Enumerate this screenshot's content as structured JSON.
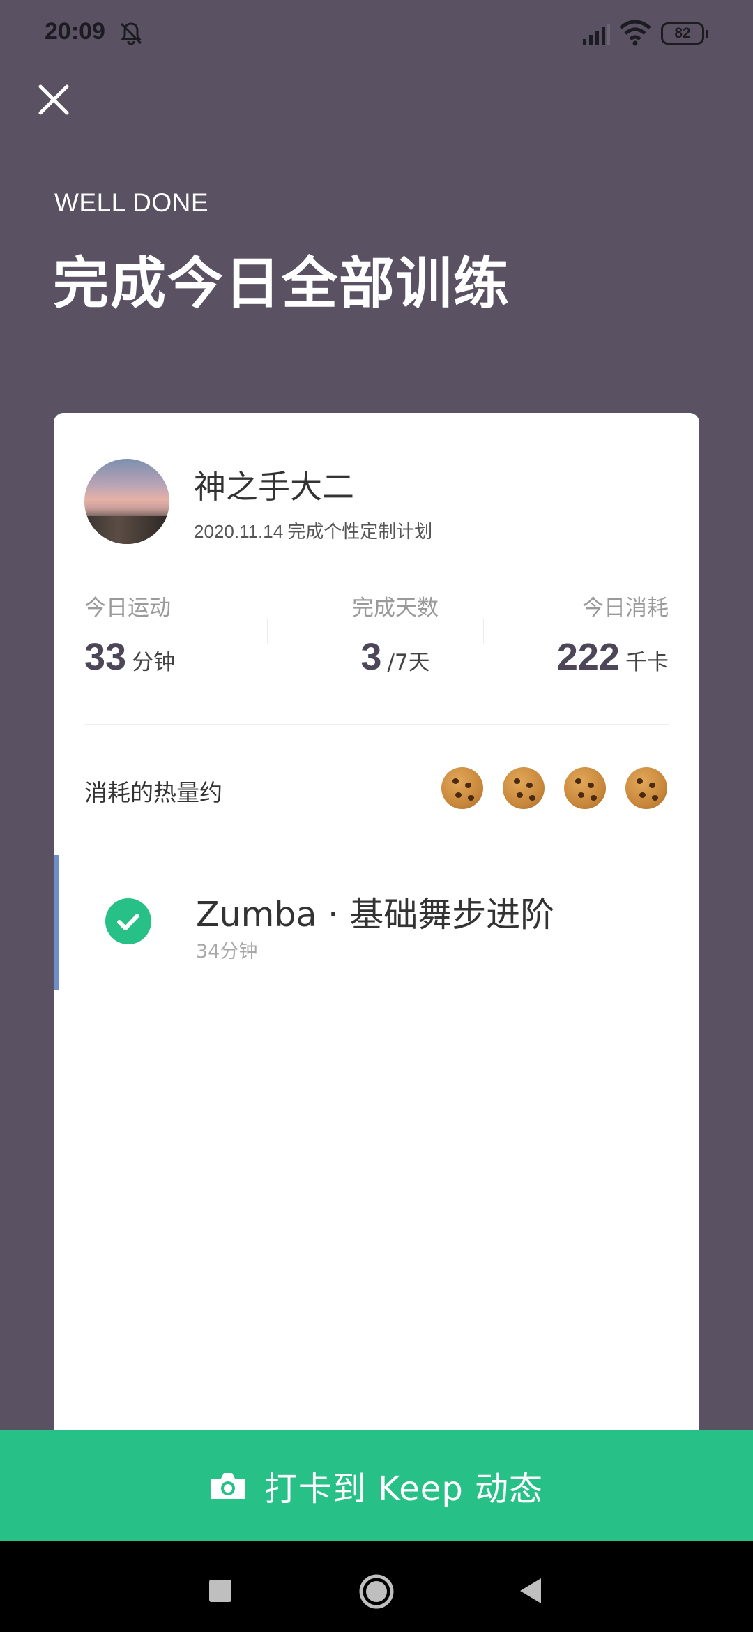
{
  "status_bar": {
    "time": "20:09",
    "battery": "82"
  },
  "header": {
    "eyebrow": "WELL DONE",
    "title": "完成今日全部训练"
  },
  "profile": {
    "name": "神之手大二",
    "date": "2020.11.14",
    "plan_text": "完成个性定制计划"
  },
  "stats": [
    {
      "label": "今日运动",
      "value": "33",
      "unit": "分钟"
    },
    {
      "label": "完成天数",
      "value": "3",
      "unit": "/7天"
    },
    {
      "label": "今日消耗",
      "value": "222",
      "unit": "千卡"
    }
  ],
  "calories": {
    "label": "消耗的热量约",
    "cookie_count": 4,
    "icon": "cookie-icon"
  },
  "workout": {
    "title": "Zumba · 基础舞步进阶",
    "duration": "34分钟",
    "status": "completed",
    "accent_color": "#6f8dc8"
  },
  "checkin": {
    "label": "打卡到 Keep 动态",
    "icon": "camera-icon",
    "color": "#27c187"
  },
  "colors": {
    "background": "#5a5262",
    "card": "#ffffff",
    "accent_green": "#27c187"
  }
}
